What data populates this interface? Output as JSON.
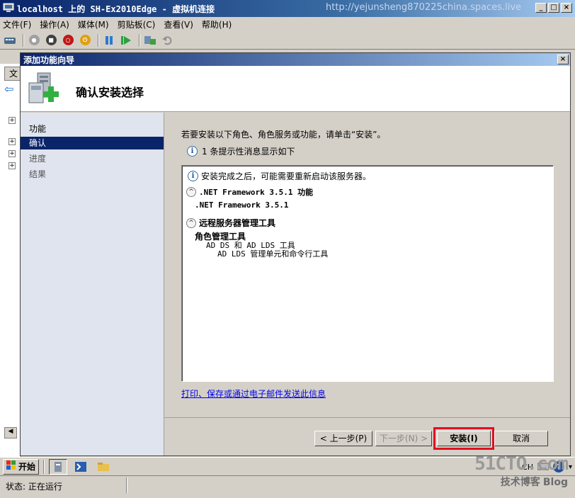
{
  "window": {
    "title": "localhost 上的 SH-Ex2010Edge - 虚拟机连接",
    "watermark_url": "http://yejunsheng870225china.spaces.live"
  },
  "menubar": {
    "items": [
      "文件(F)",
      "操作(A)",
      "媒体(M)",
      "剪贴板(C)",
      "查看(V)",
      "帮助(H)"
    ]
  },
  "server_manager": {
    "tab_label": "文"
  },
  "wizard": {
    "title": "添加功能向导",
    "header_title": "确认安装选择",
    "nav": [
      "功能",
      "确认",
      "进度",
      "结果"
    ],
    "active_nav": "确认",
    "intro": "若要安装以下角色、角色服务或功能，请单击“安装”。",
    "info_message": "1 条提示性消息显示如下",
    "results": {
      "notice": "安装完成之后，可能需要重新启动该服务器。",
      "section1_title": ".NET Framework 3.5.1 功能",
      "section1_item": ".NET Framework 3.5.1",
      "section2_title": "远程服务器管理工具",
      "role_tools": "角色管理工具",
      "ad_tools": "AD DS 和 AD LDS 工具",
      "ad_lds_tools": "AD LDS 管理单元和命令行工具"
    },
    "print_link": "打印、保存或通过电子邮件发送此信息",
    "buttons": {
      "prev": "< 上一步(P)",
      "next": "下一步(N) >",
      "install": "安装(I)",
      "cancel": "取消"
    }
  },
  "taskbar": {
    "start_label": "开始",
    "language": "CH"
  },
  "statusbar": {
    "status": "状态: 正在运行"
  },
  "watermark": {
    "site": "51CTO.com",
    "tagline": "技术博客",
    "blog": "Blog"
  },
  "colors": {
    "title_bar": "#0a246a",
    "highlight_border": "#e01020",
    "nav_active": "#0a246a",
    "link": "#0000ee"
  }
}
